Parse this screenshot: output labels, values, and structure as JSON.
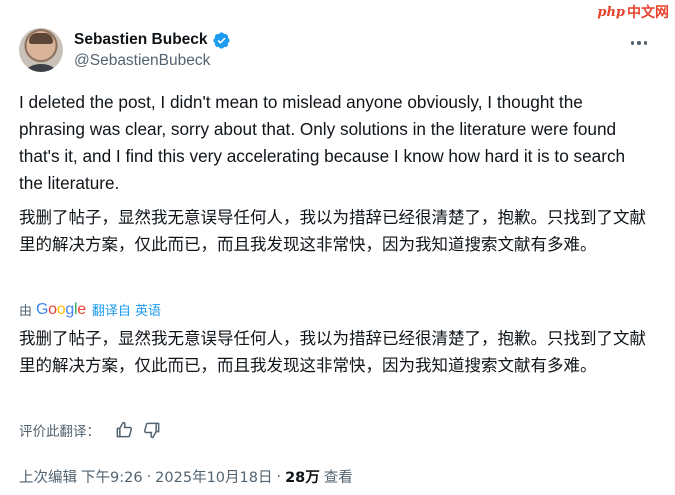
{
  "watermark": {
    "logo": "php",
    "text": "中文网"
  },
  "author": {
    "display_name": "Sebastien Bubeck",
    "handle": "@SebastienBubeck",
    "verified_color": "#1d9bf0"
  },
  "post": {
    "text_en": "I deleted the post, I didn't mean to mislead anyone obviously, I thought the phrasing was clear, sorry about that. Only solutions in the literature were found that's it, and I find this very accelerating because I know how hard it is to search the literature.",
    "text_zh": "我删了帖子，显然我无意误导任何人，我以为措辞已经很清楚了，抱歉。只找到了文献里的解决方案，仅此而已，而且我发现这非常快，因为我知道搜索文献有多难。"
  },
  "translation": {
    "by_label": "由",
    "google_letters": [
      "G",
      "o",
      "o",
      "g",
      "l",
      "e"
    ],
    "link_text": "翻译自 英语",
    "translated_text": "我删了帖子，显然我无意误导任何人，我以为措辞已经很清楚了，抱歉。只找到了文献里的解决方案，仅此而已，而且我发现这非常快，因为我知道搜索文献有多难。"
  },
  "rating": {
    "label": "评价此翻译：",
    "icons": [
      "thumbs-up-icon",
      "thumbs-down-icon"
    ]
  },
  "meta": {
    "edited_label": "上次编辑",
    "time": "下午9:26",
    "separator": "·",
    "date": "2025年10月18日",
    "views_count": "28万",
    "views_label": "查看"
  }
}
